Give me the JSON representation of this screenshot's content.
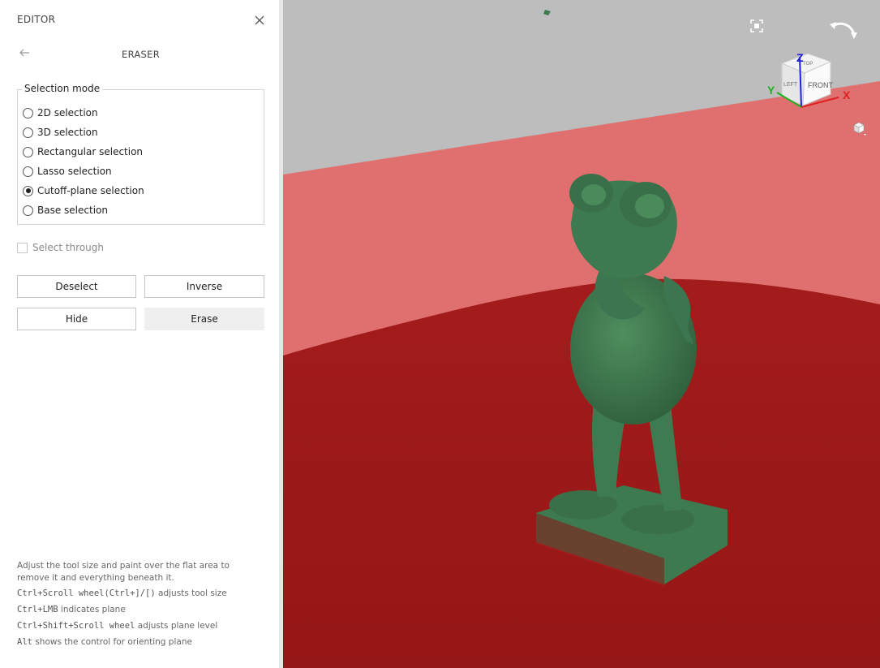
{
  "panel": {
    "header_title": "EDITOR",
    "subheader_title": "ERASER",
    "selection_mode": {
      "legend": "Selection mode",
      "options": [
        {
          "label": "2D selection",
          "checked": false
        },
        {
          "label": "3D selection",
          "checked": false
        },
        {
          "label": "Rectangular selection",
          "checked": false
        },
        {
          "label": "Lasso selection",
          "checked": false
        },
        {
          "label": "Cutoff-plane selection",
          "checked": true
        },
        {
          "label": "Base selection",
          "checked": false
        }
      ]
    },
    "select_through": {
      "label": "Select through",
      "checked": false,
      "enabled": false
    },
    "buttons": {
      "deselect": "Deselect",
      "inverse": "Inverse",
      "hide": "Hide",
      "erase": "Erase"
    },
    "help": {
      "line1": "Adjust the tool size and paint over the flat area to",
      "line2": "remove it and everything beneath it.",
      "hints": [
        {
          "keys": "Ctrl+Scroll wheel(Ctrl+]/[)",
          "text": "adjusts tool size"
        },
        {
          "keys": "Ctrl+LMB",
          "text": "indicates plane"
        },
        {
          "keys": "Ctrl+Shift+Scroll wheel",
          "text": "adjusts plane level"
        },
        {
          "keys": "Alt",
          "text": "shows the control for orienting plane"
        }
      ]
    }
  },
  "viewport": {
    "view_cube": {
      "top": "TOP",
      "front": "FRONT",
      "left": "LEFT"
    },
    "axes": {
      "x": "X",
      "y": "Y",
      "z": "Z"
    },
    "colors": {
      "background": "#bdbdbd",
      "plane_light": "#e07070",
      "floor_selected": "#a11b1b",
      "model": "#3e7a4f",
      "axis_x": "#e02020",
      "axis_y": "#20b020",
      "axis_z": "#2020e0"
    },
    "icons": [
      "fit-view-icon",
      "rotate-view-icon",
      "view-cube-menu-icon"
    ]
  }
}
